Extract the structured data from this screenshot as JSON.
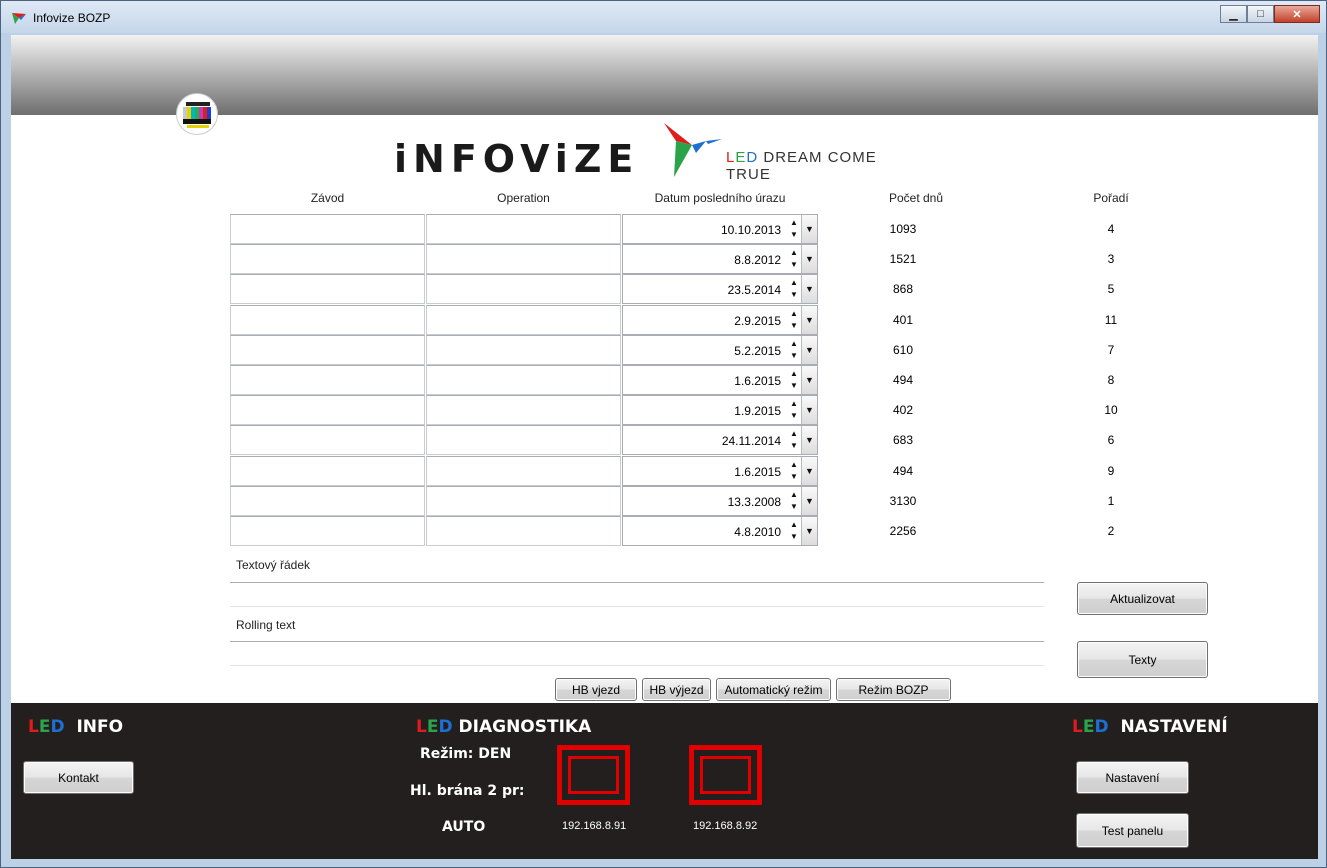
{
  "window": {
    "title": "Infovize BOZP",
    "btn_min": "▁",
    "btn_max": "□",
    "btn_close": "✕"
  },
  "logo": {
    "word": "iNFOViZE",
    "tag_rest": " DREAM COME TRUE",
    "tag_L": "L",
    "tag_E": "E",
    "tag_D": "D"
  },
  "headers": {
    "zavod": "Závod",
    "operation": "Operation",
    "datum": "Datum posledního úrazu",
    "pocet": "Počet dnů",
    "poradi": "Pořadí"
  },
  "rows": [
    {
      "date": "10.10.2013",
      "days": "1093",
      "rank": "4"
    },
    {
      "date": "8.8.2012",
      "days": "1521",
      "rank": "3"
    },
    {
      "date": "23.5.2014",
      "days": "868",
      "rank": "5"
    },
    {
      "date": "2.9.2015",
      "days": "401",
      "rank": "11"
    },
    {
      "date": "5.2.2015",
      "days": "610",
      "rank": "7"
    },
    {
      "date": "1.6.2015",
      "days": "494",
      "rank": "8"
    },
    {
      "date": "1.9.2015",
      "days": "402",
      "rank": "10"
    },
    {
      "date": "24.11.2014",
      "days": "683",
      "rank": "6"
    },
    {
      "date": "1.6.2015",
      "days": "494",
      "rank": "9"
    },
    {
      "date": "13.3.2008",
      "days": "3130",
      "rank": "1"
    },
    {
      "date": "4.8.2010",
      "days": "2256",
      "rank": "2"
    }
  ],
  "spin_glyph": "▲\n▼",
  "drop_glyph": "▼",
  "textovy_label": "Textový řádek",
  "rolling_label": "Rolling text",
  "buttons": {
    "aktualizovat": "Aktualizovat",
    "texty": "Texty",
    "hb_vjezd": "HB vjezd",
    "hb_vyjezd": "HB výjezd",
    "auto": "Automatický režim",
    "bozp": "Režim BOZP",
    "kontakt": "Kontakt",
    "nastaveni": "Nastavení",
    "test": "Test panelu"
  },
  "bottom": {
    "info": "INFO",
    "diagnostika": "DIAGNOSTIKA",
    "nastaveni_title": "NASTAVENÍ",
    "rezim": "Režim: DEN",
    "brana": "Hl. brána 2 pr:",
    "auto": "AUTO",
    "ip1": "192.168.8.91",
    "ip2": "192.168.8.92",
    "L": "L",
    "E": "E",
    "D": "D"
  },
  "colors": {
    "led_red": "#e21b1b",
    "led_green": "#2aa34a",
    "led_blue": "#1d6fd1",
    "status_red": "#e00000"
  },
  "icons": {
    "app": "infovize-bird-icon",
    "tv": "tv-test-pattern-icon",
    "spinner": "up-down-spinner-icon",
    "dropdown": "chevron-down-icon"
  }
}
